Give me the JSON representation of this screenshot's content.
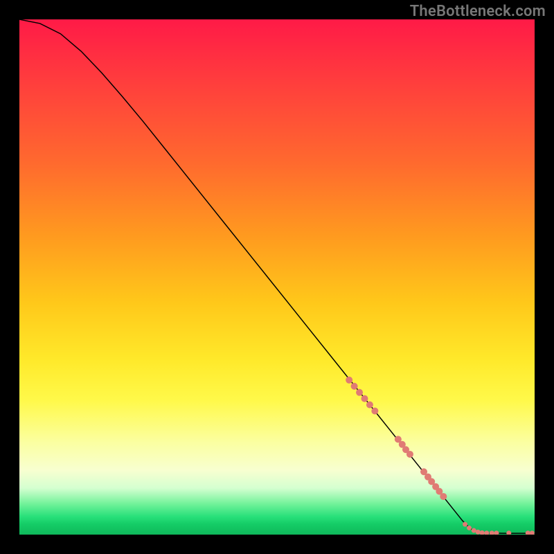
{
  "watermark": "TheBottleneck.com",
  "chart_data": {
    "type": "line",
    "title": "",
    "xlabel": "",
    "ylabel": "",
    "xlim": [
      0,
      100
    ],
    "ylim": [
      0,
      100
    ],
    "curve": [
      {
        "x": 0,
        "y": 100.0
      },
      {
        "x": 4,
        "y": 99.2
      },
      {
        "x": 8,
        "y": 97.2
      },
      {
        "x": 12,
        "y": 93.8
      },
      {
        "x": 16,
        "y": 89.6
      },
      {
        "x": 20,
        "y": 85.0
      },
      {
        "x": 24,
        "y": 80.2
      },
      {
        "x": 28,
        "y": 75.2
      },
      {
        "x": 32,
        "y": 70.2
      },
      {
        "x": 36,
        "y": 65.2
      },
      {
        "x": 40,
        "y": 60.2
      },
      {
        "x": 44,
        "y": 55.2
      },
      {
        "x": 48,
        "y": 50.2
      },
      {
        "x": 52,
        "y": 45.2
      },
      {
        "x": 56,
        "y": 40.2
      },
      {
        "x": 60,
        "y": 35.2
      },
      {
        "x": 64,
        "y": 30.2
      },
      {
        "x": 68,
        "y": 25.2
      },
      {
        "x": 72,
        "y": 20.2
      },
      {
        "x": 76,
        "y": 15.2
      },
      {
        "x": 80,
        "y": 10.2
      },
      {
        "x": 84,
        "y": 5.2
      },
      {
        "x": 86,
        "y": 2.7
      },
      {
        "x": 87.5,
        "y": 1.2
      },
      {
        "x": 88.5,
        "y": 0.6
      },
      {
        "x": 90,
        "y": 0.3
      },
      {
        "x": 92,
        "y": 0.28
      },
      {
        "x": 94,
        "y": 0.26
      },
      {
        "x": 96,
        "y": 0.26
      },
      {
        "x": 98,
        "y": 0.26
      },
      {
        "x": 100,
        "y": 0.26
      }
    ],
    "points": [
      {
        "x": 64.0,
        "y": 30.0,
        "r": 1.0
      },
      {
        "x": 65.0,
        "y": 28.8,
        "r": 1.0
      },
      {
        "x": 66.0,
        "y": 27.6,
        "r": 1.0
      },
      {
        "x": 67.0,
        "y": 26.4,
        "r": 1.0
      },
      {
        "x": 68.0,
        "y": 25.2,
        "r": 1.0
      },
      {
        "x": 69.0,
        "y": 24.0,
        "r": 1.0
      },
      {
        "x": 73.5,
        "y": 18.5,
        "r": 1.0
      },
      {
        "x": 74.3,
        "y": 17.5,
        "r": 1.0
      },
      {
        "x": 75.0,
        "y": 16.5,
        "r": 1.0
      },
      {
        "x": 75.8,
        "y": 15.6,
        "r": 1.0
      },
      {
        "x": 78.5,
        "y": 12.2,
        "r": 1.0
      },
      {
        "x": 79.3,
        "y": 11.2,
        "r": 1.0
      },
      {
        "x": 80.0,
        "y": 10.3,
        "r": 1.0
      },
      {
        "x": 80.8,
        "y": 9.3,
        "r": 1.0
      },
      {
        "x": 81.5,
        "y": 8.4,
        "r": 1.0
      },
      {
        "x": 82.3,
        "y": 7.4,
        "r": 1.0
      },
      {
        "x": 86.5,
        "y": 2.0,
        "r": 0.7
      },
      {
        "x": 87.3,
        "y": 1.3,
        "r": 0.7
      },
      {
        "x": 88.2,
        "y": 0.8,
        "r": 0.7
      },
      {
        "x": 89.0,
        "y": 0.5,
        "r": 0.7
      },
      {
        "x": 89.8,
        "y": 0.35,
        "r": 0.7
      },
      {
        "x": 90.7,
        "y": 0.3,
        "r": 0.7
      },
      {
        "x": 91.7,
        "y": 0.3,
        "r": 0.7
      },
      {
        "x": 92.6,
        "y": 0.3,
        "r": 0.7
      },
      {
        "x": 95.0,
        "y": 0.3,
        "r": 0.7
      },
      {
        "x": 98.7,
        "y": 0.3,
        "r": 0.7
      },
      {
        "x": 99.5,
        "y": 0.3,
        "r": 0.7
      }
    ],
    "point_color": "#e07b74",
    "point_radius_px": 5
  }
}
